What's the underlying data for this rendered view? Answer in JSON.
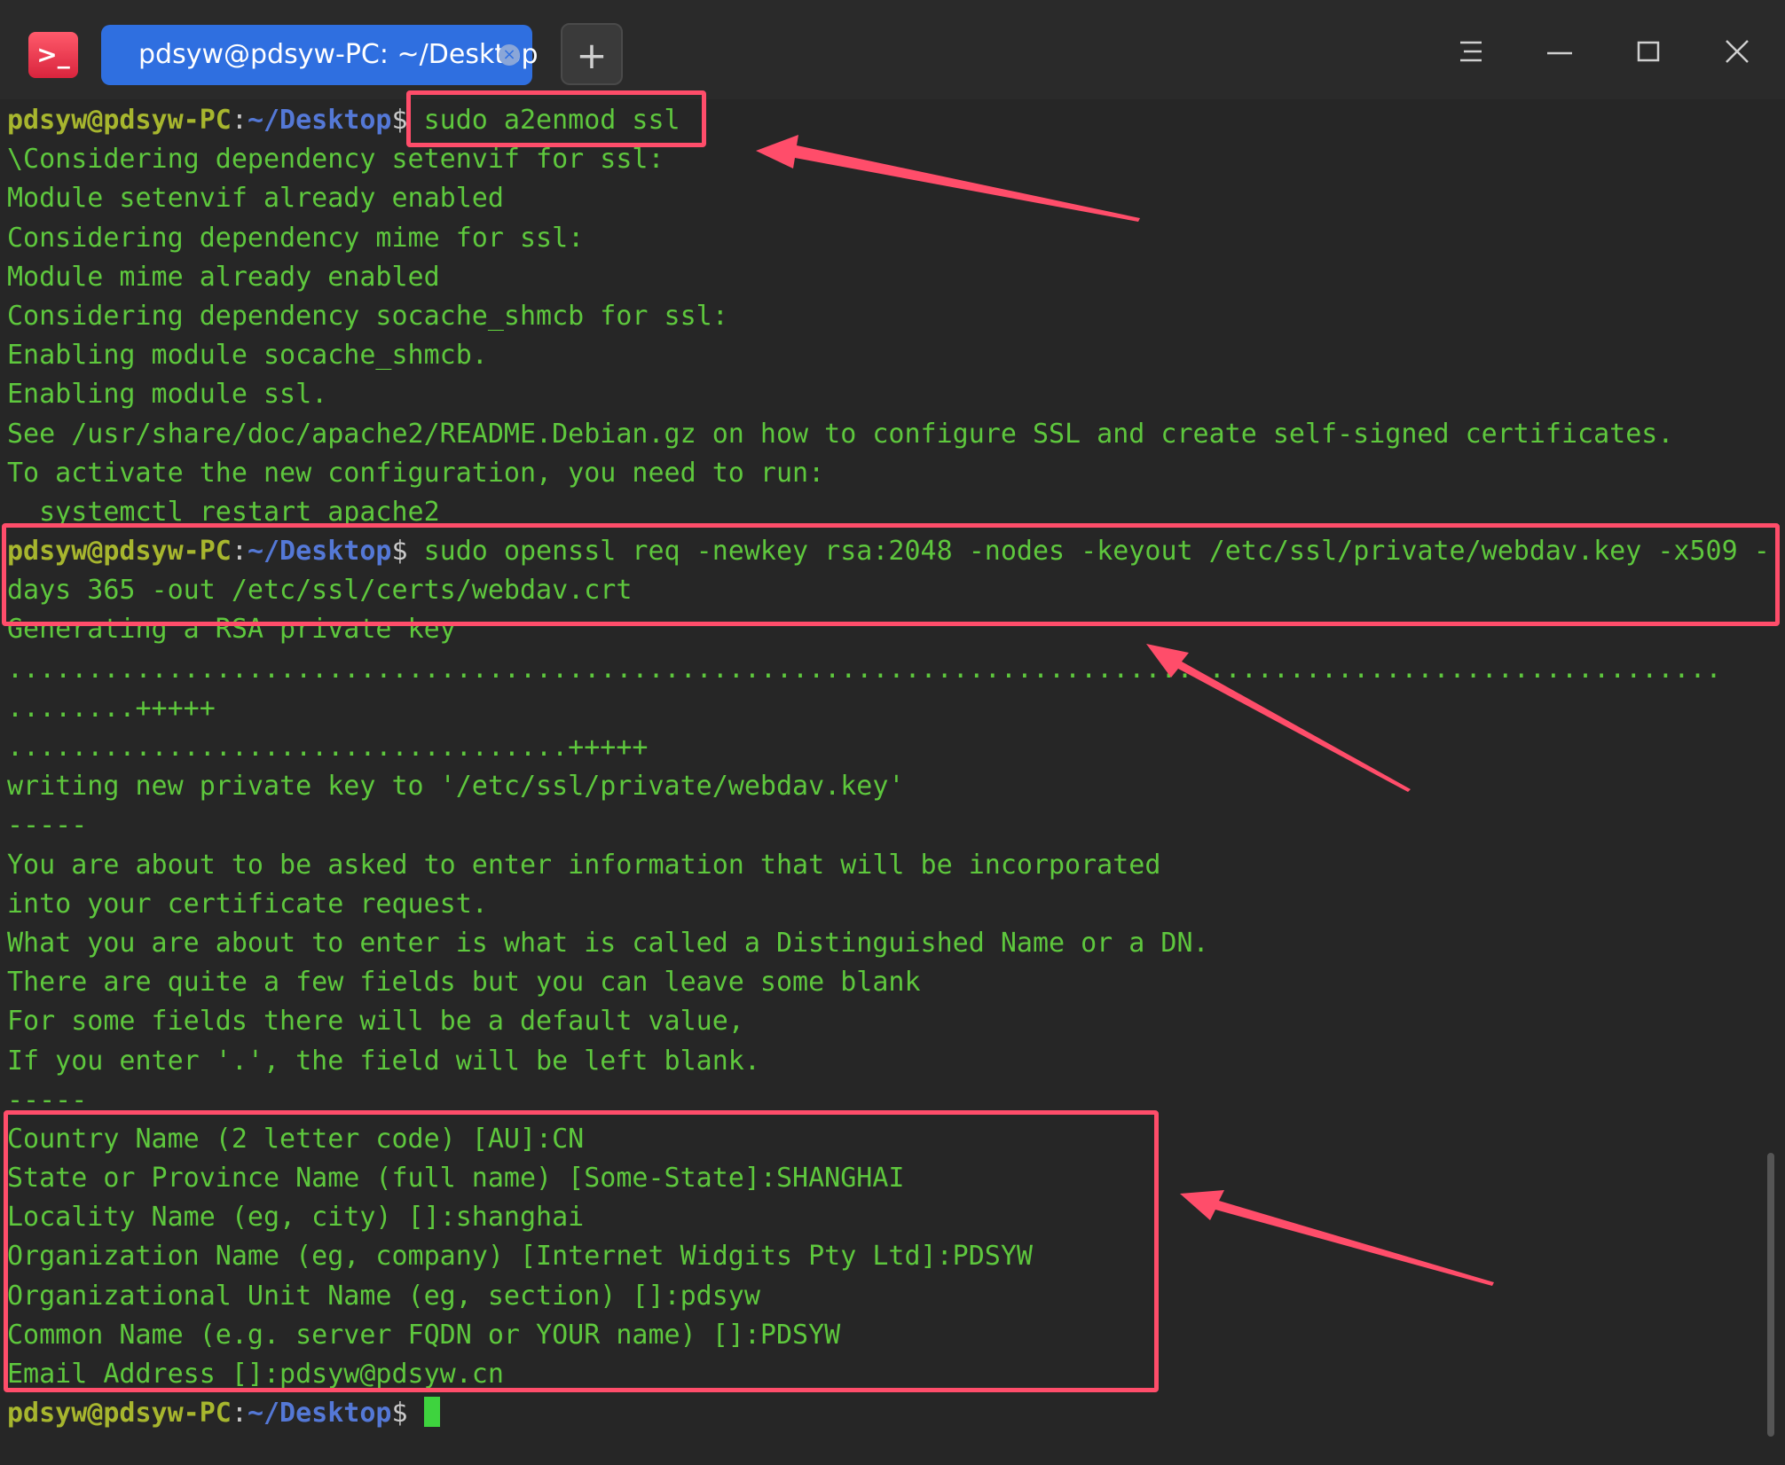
{
  "window": {
    "tab_title": "pdsyw@pdsyw-PC: ~/Desktop",
    "tab_close": "×",
    "new_tab": "+"
  },
  "prompt": {
    "user_host": "pdsyw@pdsyw-PC",
    "colon": ":",
    "path": "~/Desktop",
    "dollar": "$"
  },
  "commands": {
    "cmd1": " sudo a2enmod ssl",
    "cmd2_part1": " sudo openssl req -newkey rsa:2048 -nodes -keyout /etc/ssl/private/webdav.key -x509 -",
    "cmd2_part2": "days 365 -out /etc/ssl/certs/webdav.crt",
    "cmd3": " "
  },
  "output": {
    "a2enmod": [
      "\\Considering dependency setenvif for ssl:",
      "Module setenvif already enabled",
      "Considering dependency mime for ssl:",
      "Module mime already enabled",
      "Considering dependency socache_shmcb for ssl:",
      "Enabling module socache_shmcb.",
      "Enabling module ssl.",
      "See /usr/share/doc/apache2/README.Debian.gz on how to configure SSL and create self-signed certificates.",
      "To activate the new configuration, you need to run:",
      "  systemctl restart apache2"
    ],
    "openssl": [
      "Generating a RSA private key",
      "...........................................................................................................",
      "........+++++",
      "...................................+++++",
      "writing new private key to '/etc/ssl/private/webdav.key'",
      "-----",
      "You are about to be asked to enter information that will be incorporated",
      "into your certificate request.",
      "What you are about to enter is what is called a Distinguished Name or a DN.",
      "There are quite a few fields but you can leave some blank",
      "For some fields there will be a default value,",
      "If you enter '.', the field will be left blank.",
      "-----",
      "Country Name (2 letter code) [AU]:CN",
      "State or Province Name (full name) [Some-State]:SHANGHAI",
      "Locality Name (eg, city) []:shanghai",
      "Organization Name (eg, company) [Internet Widgits Pty Ltd]:PDSYW",
      "Organizational Unit Name (eg, section) []:pdsyw",
      "Common Name (e.g. server FQDN or YOUR name) []:PDSYW",
      "Email Address []:pdsyw@pdsyw.cn"
    ]
  },
  "colors": {
    "terminal_bg": "#262626",
    "text_green": "#5ec73d",
    "prompt_user": "#a7b62e",
    "prompt_path": "#5478d6",
    "highlight": "#ff4d6a",
    "tab_active": "#2f6fe0"
  },
  "icons": [
    "terminal-app-icon",
    "close-tab-icon",
    "menu-icon",
    "minimize-icon",
    "maximize-icon",
    "close-icon"
  ]
}
